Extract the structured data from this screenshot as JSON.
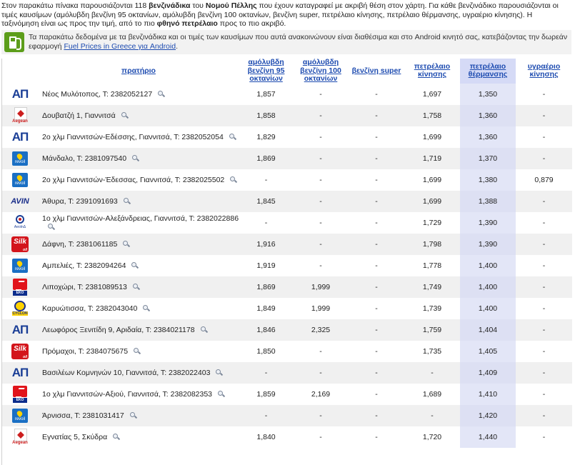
{
  "intro": {
    "p1": "Στον παρακάτω πίνακα παρουσιάζονται 118 ",
    "b1": "βενζινάδικα",
    "p2": " του ",
    "b2": "Νομού Πέλλης",
    "p3": " που έχουν καταγραφεί με ακριβή θέση στον χάρτη. Για κάθε βενζινάδικο παρουσιάζονται οι τιμές καυσίμων (αμόλυβδη βενζίνη 95 οκτανίων, αμόλυβδη βενζίνη 100 οκτανίων, βενζίνη super, πετρέλαιο κίνησης, πετρέλαιο θέρμανσης, υγραέριο κίνησης). Η ταξινόμηση είναι ως προς την τιμή, από το πιο ",
    "b3": "φθηνό πετρέλαιο",
    "p4": " προς το πιο ακριβό."
  },
  "notice": {
    "text_before": "Τα παρακάτω δεδομένα με τα βενζινάδικα και οι τιμές των καυσίμων που αυτά ανακοινώνουν είναι διαθέσιμα και στο Android κινητό σας, κατεβάζοντας την δωρεάν εφαρμογή ",
    "link": "Fuel Prices in Greece για Android",
    "text_after": "."
  },
  "headers": {
    "station": "πρατήριο",
    "unl95": "αμόλυβδη βενζίνη 95 οκτανίων",
    "unl100": "αμόλυβδη βενζίνη 100 οκτανίων",
    "super": "βενζίνη super",
    "diesel": "πετρέλαιο κίνησης",
    "heating": "πετρέλαιο θέρμανσης",
    "lpg": "υγραέριο κίνησης"
  },
  "brands": {
    "ap": "ΑΠ",
    "aegean": "Aegean",
    "revoil": "revoil",
    "avin": "AVIN",
    "aeo": "AeolnΔ",
    "silk": "Silk",
    "eko": "EKO",
    "cyclon": "CYCLON"
  },
  "rows": [
    {
      "brand": "ap",
      "station": "Νέος Μυλότοπος, Τ: 2382052127",
      "unl95": "1,857",
      "unl100": "-",
      "super": "-",
      "diesel": "1,697",
      "heating": "1,350",
      "lpg": "-"
    },
    {
      "brand": "aegean",
      "station": "Δουβατζή 1, Γιαννιτσά",
      "unl95": "1,858",
      "unl100": "-",
      "super": "-",
      "diesel": "1,758",
      "heating": "1,360",
      "lpg": "-"
    },
    {
      "brand": "ap",
      "station": "2ο χλμ Γιαννιτσών-Εδέσσης, Γιαννιτσά, Τ: 2382052054",
      "unl95": "1,829",
      "unl100": "-",
      "super": "-",
      "diesel": "1,699",
      "heating": "1,360",
      "lpg": "-"
    },
    {
      "brand": "revoil",
      "station": "Μάνδαλο, Τ: 2381097540",
      "unl95": "1,869",
      "unl100": "-",
      "super": "-",
      "diesel": "1,719",
      "heating": "1,370",
      "lpg": "-"
    },
    {
      "brand": "revoil",
      "station": "2ο χλμ Γιαννιτσών-Έδεσσας, Γιαννιτσά, Τ: 2382025502",
      "unl95": "-",
      "unl100": "-",
      "super": "-",
      "diesel": "1,699",
      "heating": "1,380",
      "lpg": "0,879"
    },
    {
      "brand": "avin",
      "station": "Άθυρα, Τ: 2391091693",
      "unl95": "1,845",
      "unl100": "-",
      "super": "-",
      "diesel": "1,699",
      "heating": "1,388",
      "lpg": "-"
    },
    {
      "brand": "aeo",
      "station": "1ο χλμ Γιαννιτσών-Αλεξάνδρειας, Γιαννιτσά, Τ: 2382022886",
      "unl95": "-",
      "unl100": "-",
      "super": "-",
      "diesel": "1,729",
      "heating": "1,390",
      "lpg": "-"
    },
    {
      "brand": "silk",
      "station": "Δάφνη, Τ: 2381061185",
      "unl95": "1,916",
      "unl100": "-",
      "super": "-",
      "diesel": "1,798",
      "heating": "1,390",
      "lpg": "-"
    },
    {
      "brand": "revoil",
      "station": "Αμπελιές, Τ: 2382094264",
      "unl95": "1,919",
      "unl100": "-",
      "super": "-",
      "diesel": "1,778",
      "heating": "1,400",
      "lpg": "-"
    },
    {
      "brand": "eko",
      "station": "Λιποχώρι, Τ: 2381089513",
      "unl95": "1,869",
      "unl100": "1,999",
      "super": "-",
      "diesel": "1,749",
      "heating": "1,400",
      "lpg": "-"
    },
    {
      "brand": "cyclon",
      "station": "Καρυώτισσα, Τ: 2382043040",
      "unl95": "1,849",
      "unl100": "1,999",
      "super": "-",
      "diesel": "1,739",
      "heating": "1,400",
      "lpg": "-"
    },
    {
      "brand": "ap",
      "station": "Λεωφόρος Ξενιτίδη 9, Αριδαία, Τ: 2384021178",
      "unl95": "1,846",
      "unl100": "2,325",
      "super": "-",
      "diesel": "1,759",
      "heating": "1,404",
      "lpg": "-"
    },
    {
      "brand": "silk",
      "station": "Πρόμαχοι, Τ: 2384075675",
      "unl95": "1,850",
      "unl100": "-",
      "super": "-",
      "diesel": "1,735",
      "heating": "1,405",
      "lpg": "-"
    },
    {
      "brand": "ap",
      "station": "Βασιλέων Κομνηνών 10, Γιαννιτσά, Τ: 2382022403",
      "unl95": "-",
      "unl100": "-",
      "super": "-",
      "diesel": "-",
      "heating": "1,409",
      "lpg": "-"
    },
    {
      "brand": "eko",
      "station": "1ο χλμ Γιαννιτσών-Αξιού, Γιαννιτσά, Τ: 2382082353",
      "unl95": "1,859",
      "unl100": "2,169",
      "super": "-",
      "diesel": "1,689",
      "heating": "1,410",
      "lpg": "-"
    },
    {
      "brand": "revoil",
      "station": "Άρνισσα, Τ: 2381031417",
      "unl95": "-",
      "unl100": "-",
      "super": "-",
      "diesel": "-",
      "heating": "1,420",
      "lpg": "-"
    },
    {
      "brand": "aegean",
      "station": "Εγνατίας 5, Σκύδρα",
      "unl95": "1,840",
      "unl100": "-",
      "super": "-",
      "diesel": "1,720",
      "heating": "1,440",
      "lpg": "-"
    }
  ]
}
